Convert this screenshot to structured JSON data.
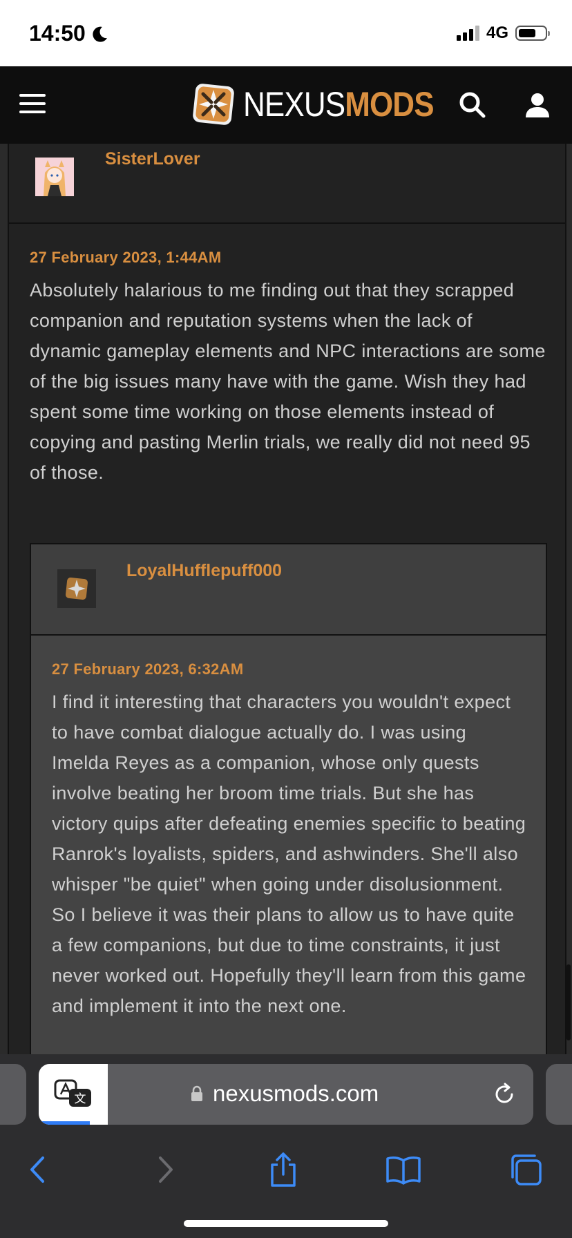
{
  "status_bar": {
    "time": "14:50",
    "network": "4G"
  },
  "site": {
    "brand_part1": "NEXUS",
    "brand_part2": "MODS",
    "accent_color": "#d98f40"
  },
  "comment": {
    "username": "SisterLover",
    "date": "27 February 2023, 1:44AM",
    "text": "Absolutely halarious to me finding out that they scrapped companion and reputation systems when the lack of dynamic gameplay elements and NPC interactions are some of the big issues many have with the game. Wish they had spent some time working on those elements instead of copying and pasting Merlin trials, we really did not need 95 of those."
  },
  "reply": {
    "username": "LoyalHufflepuff000",
    "date": "27 February 2023, 6:32AM",
    "text": "I find it interesting that characters you wouldn't expect to have combat dialogue actually do. I was using Imelda Reyes as a companion, whose only quests involve beating her broom time trials. But she has victory quips after defeating enemies specific to beating Ranrok's loyalists, spiders, and ashwinders. She'll also whisper \"be quiet\" when going under disolusionment. So I believe it was their plans to allow us to have quite a few companions, but due to time constraints, it just never worked out. Hopefully they'll learn from this game and implement it into the next one."
  },
  "browser": {
    "url": "nexusmods.com",
    "icons": [
      "translate-icon",
      "lock-icon",
      "reload-icon",
      "back-icon",
      "forward-icon",
      "share-icon",
      "bookmarks-icon",
      "tabs-icon"
    ]
  }
}
